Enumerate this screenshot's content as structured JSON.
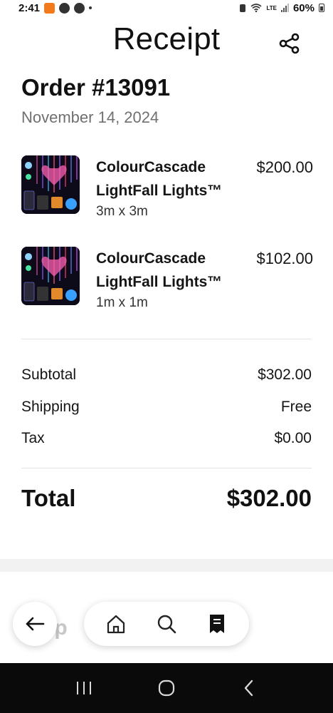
{
  "status_bar": {
    "time": "2:41",
    "temu_badge": "TEMU",
    "battery": "60%",
    "network": "LTE"
  },
  "header": {
    "title": "Receipt",
    "share_icon": "share-icon"
  },
  "order": {
    "number": "Order #13091",
    "date": "November 14, 2024"
  },
  "items": [
    {
      "name": "ColourCascade LightFall Lights™",
      "variant": "3m x 3m",
      "price": "$200.00"
    },
    {
      "name": "ColourCascade LightFall Lights™",
      "variant": "1m x 1m",
      "price": "$102.00"
    }
  ],
  "summary": {
    "subtotal_label": "Subtotal",
    "subtotal_value": "$302.00",
    "shipping_label": "Shipping",
    "shipping_value": "Free",
    "tax_label": "Tax",
    "tax_value": "$0.00",
    "total_label": "Total",
    "total_value": "$302.00"
  },
  "below_fold": {
    "peek_text": "pp"
  },
  "bottom_nav": {
    "back_icon": "arrow-left-icon",
    "home_icon": "home-icon",
    "search_icon": "search-icon",
    "receipt_icon": "receipt-icon"
  },
  "colors": {
    "text_primary": "#111111",
    "text_secondary": "#707070",
    "divider": "#e2e2e2",
    "system_nav": "#0a0a0a"
  }
}
